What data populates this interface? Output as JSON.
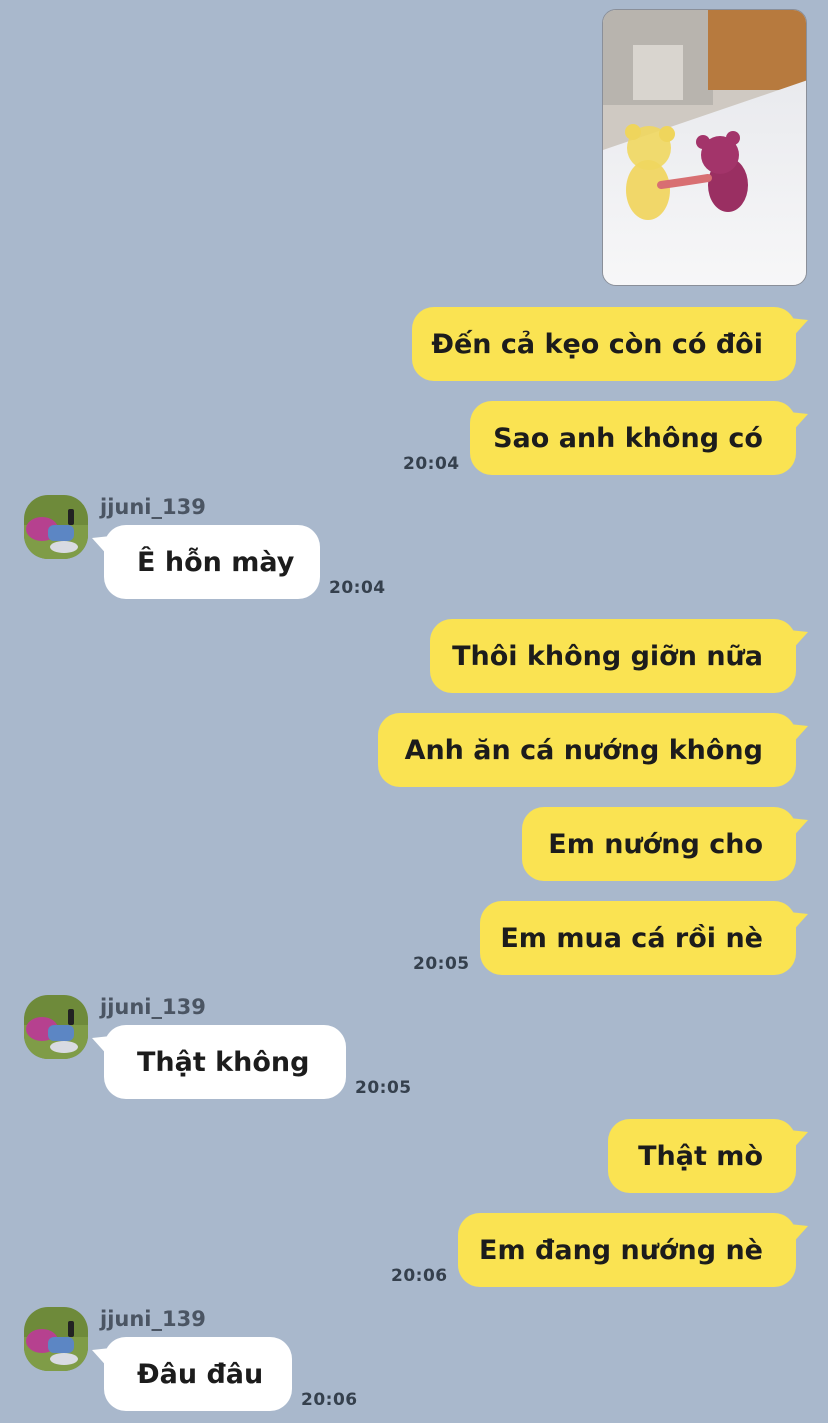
{
  "photo": {
    "description_icon": "photo-gummy-bears"
  },
  "contact": {
    "name": "jjuni_139"
  },
  "colors": {
    "background": "#a9b8cc",
    "me_bubble": "#fae352",
    "them_bubble": "#ffffff"
  },
  "messages": [
    {
      "from": "me",
      "text": "Đến cả kẹo còn có đôi"
    },
    {
      "from": "me",
      "text": "Sao anh không có",
      "time": "20:04"
    },
    {
      "from": "them",
      "text": "Ê hỗn mày",
      "time": "20:04"
    },
    {
      "from": "me",
      "text": "Thôi không giỡn nữa"
    },
    {
      "from": "me",
      "text": "Anh ăn cá nướng không"
    },
    {
      "from": "me",
      "text": "Em nướng cho"
    },
    {
      "from": "me",
      "text": "Em mua cá rồi nè",
      "time": "20:05"
    },
    {
      "from": "them",
      "text": "Thật không",
      "time": "20:05"
    },
    {
      "from": "me",
      "text": "Thật mò"
    },
    {
      "from": "me",
      "text": "Em đang nướng nè",
      "time": "20:06"
    },
    {
      "from": "them",
      "text": "Đâu đâu",
      "time": "20:06"
    }
  ]
}
